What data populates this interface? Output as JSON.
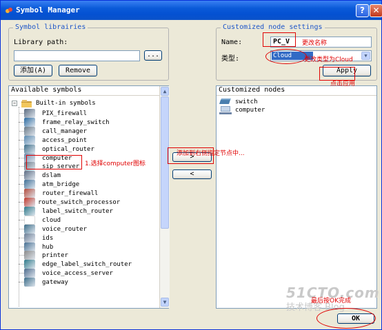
{
  "window": {
    "title": "Symbol Manager",
    "help_label": "?",
    "close_label": "✕"
  },
  "library": {
    "group_title": "Symbol librairies",
    "path_label": "Library path:",
    "path_value": "",
    "browse_label": "...",
    "add_label": "添加(A)",
    "remove_label": "Remove"
  },
  "custom_settings": {
    "group_title": "Customized node settings",
    "name_label": "Name:",
    "name_value": "PC_V",
    "type_label": "类型:",
    "type_value": "Cloud",
    "apply_label": "Apply"
  },
  "available": {
    "header": "Available symbols",
    "root_label": "Built-in symbols",
    "items": [
      {
        "label": "PIX_firewall",
        "icon": "firewall-icon",
        "color": "#5a6b80"
      },
      {
        "label": "frame_relay_switch",
        "icon": "switch-icon",
        "color": "#2a6aa0"
      },
      {
        "label": "call_manager",
        "icon": "server-icon",
        "color": "#6a7a88"
      },
      {
        "label": "access_point",
        "icon": "access-point-icon",
        "color": "#5a8ab0"
      },
      {
        "label": "optical_router",
        "icon": "router-icon",
        "color": "#3d6e8a"
      },
      {
        "label": "computer",
        "icon": "computer-icon",
        "color": "#6f86a8"
      },
      {
        "label": "sip_server",
        "icon": "server-icon",
        "color": "#6a7a88"
      },
      {
        "label": "dslam",
        "icon": "dslam-icon",
        "color": "#5d6d84"
      },
      {
        "label": "atm_bridge",
        "icon": "bridge-icon",
        "color": "#3f6f96"
      },
      {
        "label": "router_firewall",
        "icon": "router-firewall-icon",
        "color": "#b34a3a"
      },
      {
        "label": "route_switch_processor",
        "icon": "processor-icon",
        "color": "#c0392b"
      },
      {
        "label": "label_switch_router",
        "icon": "router-icon",
        "color": "#2f7a8a"
      },
      {
        "label": "cloud",
        "icon": "cloud-icon",
        "color": "#ffffff"
      },
      {
        "label": "voice_router",
        "icon": "router-icon",
        "color": "#3d6e8a"
      },
      {
        "label": "ids",
        "icon": "ids-icon",
        "color": "#6d7f96"
      },
      {
        "label": "hub",
        "icon": "hub-icon",
        "color": "#466f92"
      },
      {
        "label": "printer",
        "icon": "printer-icon",
        "color": "#8a8a8a"
      },
      {
        "label": "edge_label_switch_router",
        "icon": "router-icon",
        "color": "#2f7a8a"
      },
      {
        "label": "voice_access_server",
        "icon": "server-icon",
        "color": "#4d6b8d"
      },
      {
        "label": "gateway",
        "icon": "router-icon",
        "color": "#3d6e8a"
      }
    ]
  },
  "customized": {
    "header": "Customized nodes",
    "items": [
      {
        "label": "switch",
        "icon": "switch-icon"
      },
      {
        "label": "computer",
        "icon": "computer-icon"
      }
    ]
  },
  "transfer": {
    "add_arrow": ">",
    "remove_arrow": "<"
  },
  "ok_label": "OK",
  "annotations": {
    "name_note": "更改名称",
    "type_note": "更改类型为Cloud",
    "apply_note": "点击应用",
    "select_note": "1.选择computer图标",
    "add_note": "添加到右侧指定节点中...",
    "ok_note": "最后按OK完成"
  },
  "watermark": {
    "line1": "51CTO.com",
    "line2": "技术博客  Blog"
  },
  "colors": {
    "title_bar": "#0a5ad8",
    "annotation_red": "#e00000",
    "group_title_blue": "#1c54c8",
    "selection_blue": "#316ac5"
  }
}
